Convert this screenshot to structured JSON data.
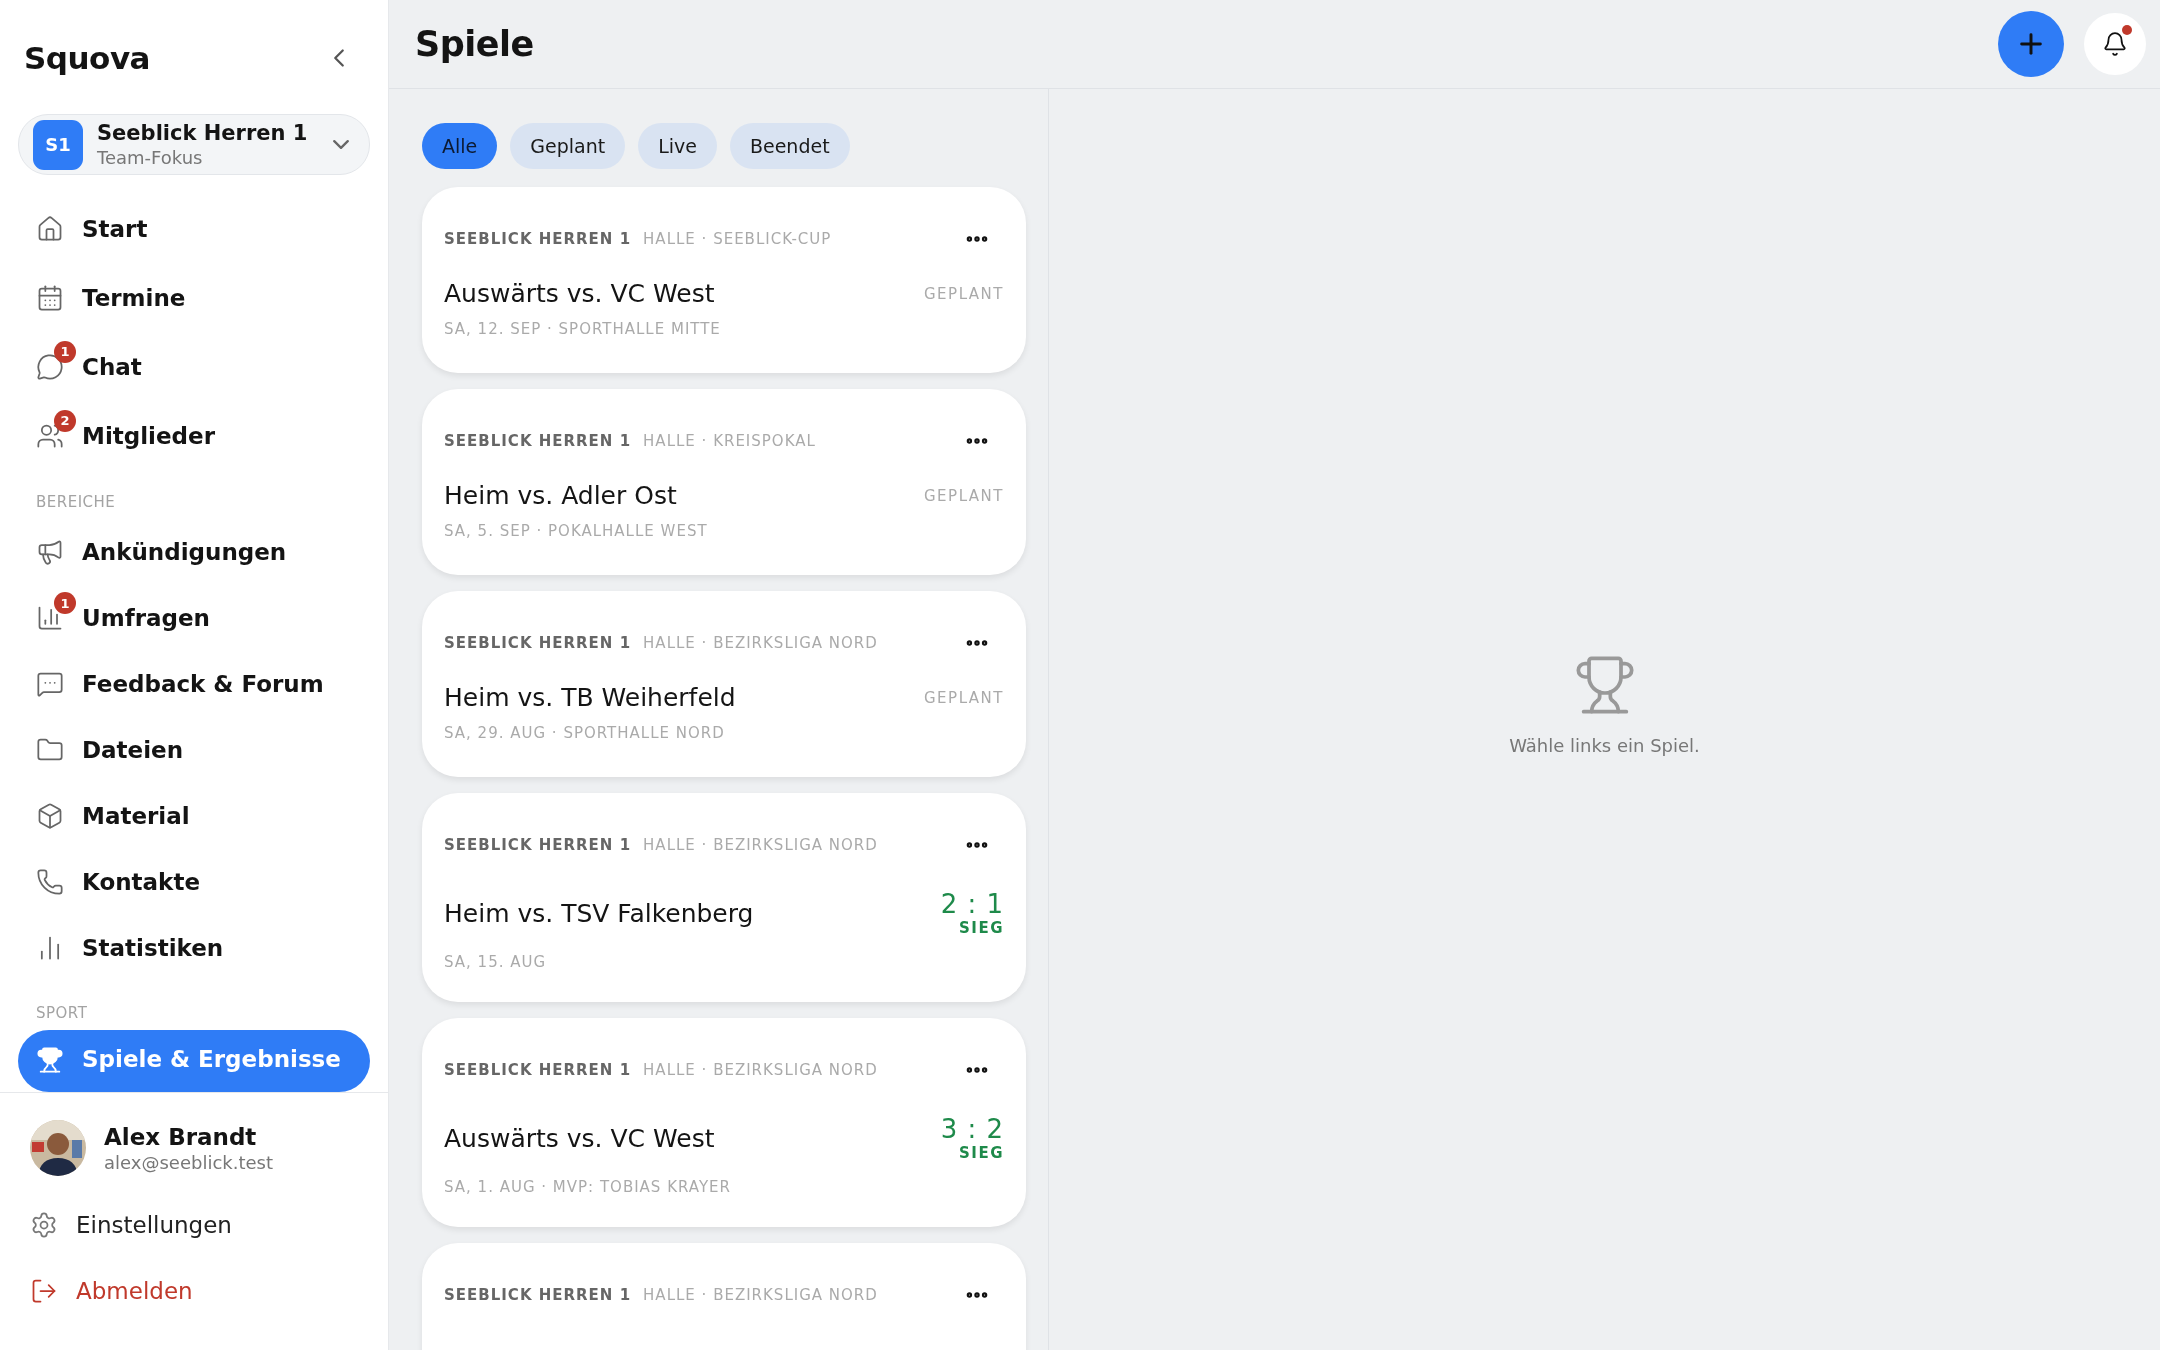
{
  "sidebar": {
    "brand": "Squova",
    "team": {
      "initials": "S1",
      "name": "Seeblick Herren 1",
      "subtitle": "Team-Fokus"
    },
    "sections": [
      {
        "items": [
          {
            "label": "Start",
            "selected": false
          },
          {
            "label": "Termine",
            "selected": false
          },
          {
            "label": "Chat",
            "badge": "1",
            "selected": false
          },
          {
            "label": "Mitglieder",
            "badge": "2",
            "selected": false
          }
        ]
      },
      {
        "title": "BEREICHE",
        "items": [
          {
            "label": "Ankündigungen",
            "selected": false
          },
          {
            "label": "Umfragen",
            "badge": "1",
            "selected": false
          },
          {
            "label": "Feedback & Forum",
            "selected": false
          },
          {
            "label": "Dateien",
            "selected": false
          },
          {
            "label": "Material",
            "selected": false
          },
          {
            "label": "Kontakte",
            "selected": false
          },
          {
            "label": "Statistiken",
            "selected": false
          }
        ]
      },
      {
        "title": "SPORT",
        "items": [
          {
            "label": "Spiele & Ergebnisse",
            "selected": true
          }
        ]
      }
    ],
    "user": {
      "name": "Alex Brandt",
      "email": "alex@seeblick.test"
    },
    "footer_links": [
      {
        "kind": "settings",
        "label": "Einstellungen"
      },
      {
        "kind": "logout",
        "label": "Abmelden"
      }
    ]
  },
  "header": {
    "title": "Spiele",
    "notification_dot": true
  },
  "filters": [
    {
      "label": "Alle",
      "selected": true
    },
    {
      "label": "Geplant",
      "selected": false
    },
    {
      "label": "Live",
      "selected": false
    },
    {
      "label": "Beendet",
      "selected": false
    }
  ],
  "games": [
    {
      "kind": "planned",
      "team": "SEEBLICK HERREN 1",
      "meta": "HALLE · SEEBLICK-CUP",
      "title": "Auswärts vs. VC West",
      "status": "GEPLANT",
      "detail": "SA, 12. SEP · SPORTHALLE MITTE"
    },
    {
      "kind": "planned",
      "team": "SEEBLICK HERREN 1",
      "meta": "HALLE · KREISPOKAL",
      "title": "Heim vs. Adler Ost",
      "status": "GEPLANT",
      "detail": "SA, 5. SEP · POKALHALLE WEST"
    },
    {
      "kind": "planned",
      "team": "SEEBLICK HERREN 1",
      "meta": "HALLE · BEZIRKSLIGA NORD",
      "title": "Heim vs. TB Weiherfeld",
      "status": "GEPLANT",
      "detail": "SA, 29. AUG · SPORTHALLE NORD"
    },
    {
      "kind": "result",
      "team": "SEEBLICK HERREN 1",
      "meta": "HALLE · BEZIRKSLIGA NORD",
      "title": "Heim vs. TSV Falkenberg",
      "score": "2 : 1",
      "result": "SIEG",
      "detail": "SA, 15. AUG"
    },
    {
      "kind": "result",
      "team": "SEEBLICK HERREN 1",
      "meta": "HALLE · BEZIRKSLIGA NORD",
      "title": "Auswärts vs. VC West",
      "score": "3 : 2",
      "result": "SIEG",
      "detail": "SA, 1. AUG · MVP: TOBIAS KRAYER"
    },
    {
      "kind": "cut",
      "team": "SEEBLICK HERREN 1",
      "meta": "HALLE · BEZIRKSLIGA NORD"
    }
  ],
  "empty_state": {
    "message": "Wähle links ein Spiel."
  }
}
